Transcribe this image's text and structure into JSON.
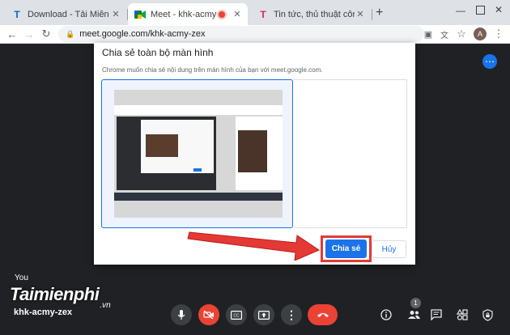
{
  "tabs": [
    {
      "title": "Download - Tải Miễn Phí VN - P",
      "icon": "taimienphi-favicon"
    },
    {
      "title": "Meet - khk-acmy-zex",
      "icon": "meet-favicon"
    },
    {
      "title": "Tin tức, thủ thuật công nghệ m",
      "icon": "taimienphi-favicon"
    }
  ],
  "toolbar": {
    "url": "meet.google.com/khk-acmy-zex",
    "avatar": "A"
  },
  "dialog": {
    "title": "Chia sẻ toàn bộ màn hình",
    "description": "Chrome muốn chia sẻ nội dung trên màn hình của bạn với meet.google.com.",
    "share_label": "Chia sẻ",
    "cancel_label": "Hủy"
  },
  "meet": {
    "self_label": "You",
    "meeting_code": "khk-acmy-zex",
    "participants_count": "1"
  },
  "watermark": {
    "text": "Taimienphi",
    "suffix": ".vn"
  },
  "colors": {
    "accent": "#1a73e8",
    "end_call": "#ea4335",
    "highlight": "#e53935",
    "meet_bg": "#202124"
  }
}
